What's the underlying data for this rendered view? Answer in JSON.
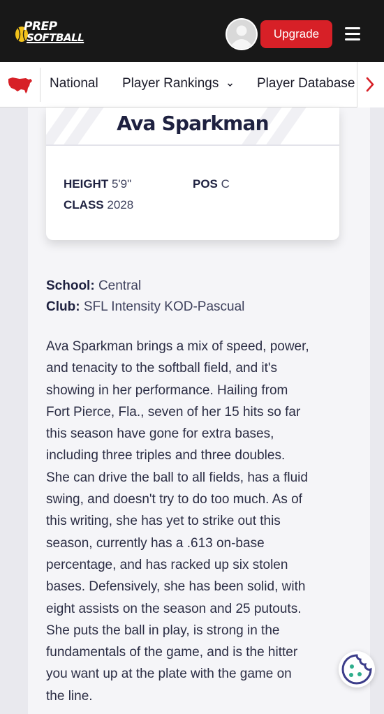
{
  "header": {
    "logo_top": "PREP",
    "logo_bottom": "SOFTBALL",
    "upgrade_label": "Upgrade"
  },
  "nav": {
    "items": [
      {
        "label": "National"
      },
      {
        "label": "Player Rankings"
      },
      {
        "label": "Player Database"
      }
    ]
  },
  "player": {
    "name": "Ava Sparkman",
    "height_label": "HEIGHT",
    "height": "5'9\"",
    "pos_label": "POS",
    "pos": "C",
    "class_label": "CLASS",
    "class_year": "2028",
    "school_label": "School:",
    "school": "Central",
    "club_label": "Club:",
    "club": "SFL Intensity KOD-Pascual"
  },
  "bio_lines": [
    "Ava Sparkman brings a mix of speed, power,",
    "and tenacity to the softball field, and it's",
    "showing in her performance. Hailing from",
    "Fort Pierce, Fla., seven of her 15 hits so far",
    "this season have gone for extra bases,",
    "including three triples and three doubles.",
    "She can drive the ball to all fields, has a fluid",
    "swing, and doesn't try to do too much. As of",
    "this writing, she has yet to strike out this",
    "season, currently has a .613 on-base",
    "percentage, and has racked up six stolen",
    "bases. Defensively, she has been solid, with",
    "eight assists on the season and 25 putouts.",
    "She puts the ball in play, is strong in the",
    "fundamentals of the game, and is the hitter",
    "you want up at the plate with the game on",
    "the line."
  ],
  "colors": {
    "topbar": "#181818",
    "upgrade": "#d72027",
    "accent_yellow": "#f2c21b",
    "navy": "#1e2140",
    "cookie": "#3c3d8a"
  }
}
